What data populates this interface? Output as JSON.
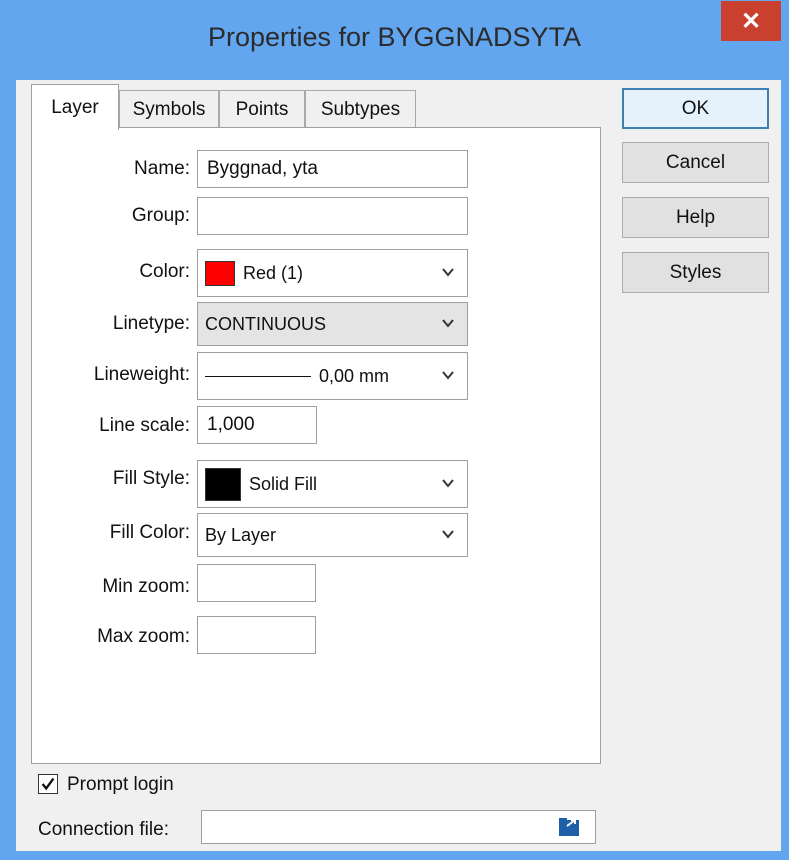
{
  "window": {
    "title": "Properties for BYGGNADSYTA",
    "close_label": "✕"
  },
  "tabs": [
    {
      "label": "Layer",
      "active": true
    },
    {
      "label": "Symbols"
    },
    {
      "label": "Points"
    },
    {
      "label": "Subtypes"
    }
  ],
  "form": {
    "name_label": "Name:",
    "name_value": "Byggnad, yta",
    "group_label": "Group:",
    "group_value": "",
    "color_label": "Color:",
    "color_value": "Red (1)",
    "color_swatch": "#ff0000",
    "linetype_label": "Linetype:",
    "linetype_value": "CONTINUOUS",
    "lineweight_label": "Lineweight:",
    "lineweight_value": "0,00 mm",
    "linescale_label": "Line scale:",
    "linescale_value": "1,000",
    "fillstyle_label": "Fill Style:",
    "fillstyle_value": "Solid Fill",
    "fillstyle_swatch": "#000000",
    "fillcolor_label": "Fill Color:",
    "fillcolor_value": "By Layer",
    "minzoom_label": "Min zoom:",
    "minzoom_value": "",
    "maxzoom_label": "Max zoom:",
    "maxzoom_value": ""
  },
  "buttons": {
    "ok": "OK",
    "cancel": "Cancel",
    "help": "Help",
    "styles": "Styles"
  },
  "footer": {
    "prompt_login_label": "Prompt login",
    "prompt_login_checked": true,
    "connection_file_label": "Connection file:",
    "connection_file_value": ""
  },
  "colors": {
    "titlebar": "#63a6f0",
    "close": "#c9402f",
    "dialog": "#f0f0f0"
  }
}
